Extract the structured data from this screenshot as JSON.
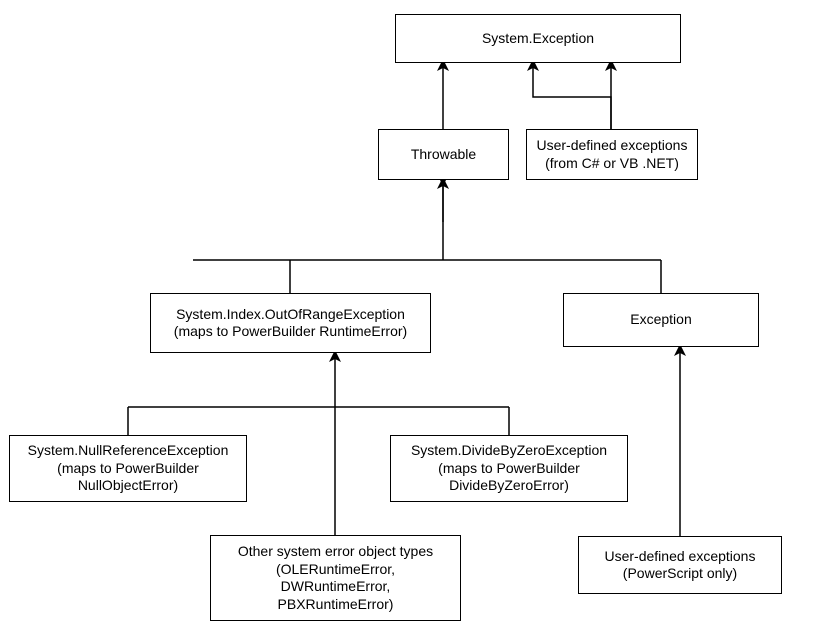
{
  "nodes": {
    "system_exception": {
      "lines": [
        "System.Exception"
      ]
    },
    "throwable": {
      "lines": [
        "Throwable"
      ]
    },
    "user_defined_net": {
      "lines": [
        "User-defined exceptions",
        "(from C# or VB .NET)"
      ]
    },
    "system_index_oor": {
      "lines": [
        "System.Index.OutOfRangeException",
        "(maps to PowerBuilder RuntimeError)"
      ]
    },
    "exception": {
      "lines": [
        "Exception"
      ]
    },
    "null_ref": {
      "lines": [
        "System.NullReferenceException",
        "(maps to PowerBuilder",
        "NullObjectError)"
      ]
    },
    "div_by_zero": {
      "lines": [
        "System.DivideByZeroException",
        "(maps to PowerBuilder",
        "DivideByZeroError)"
      ]
    },
    "other_system_errors": {
      "lines": [
        "Other system error object types",
        "(OLERuntimeError,",
        "DWRuntimeError,",
        "PBXRuntimeError)"
      ]
    },
    "user_defined_ps": {
      "lines": [
        "User-defined exceptions",
        "(PowerScript only)"
      ]
    }
  },
  "chart_data": {
    "type": "diagram",
    "direction": "child-to-parent (arrows point upward to parent)",
    "edges": [
      {
        "from": "throwable",
        "to": "system_exception"
      },
      {
        "from": "user_defined_net",
        "to": "system_exception"
      },
      {
        "from": "system_index_oor",
        "to": "throwable"
      },
      {
        "from": "exception",
        "to": "throwable"
      },
      {
        "from": "null_ref",
        "to": "system_index_oor"
      },
      {
        "from": "div_by_zero",
        "to": "system_index_oor"
      },
      {
        "from": "other_system_errors",
        "to": "system_index_oor"
      },
      {
        "from": "user_defined_ps",
        "to": "exception"
      }
    ]
  }
}
